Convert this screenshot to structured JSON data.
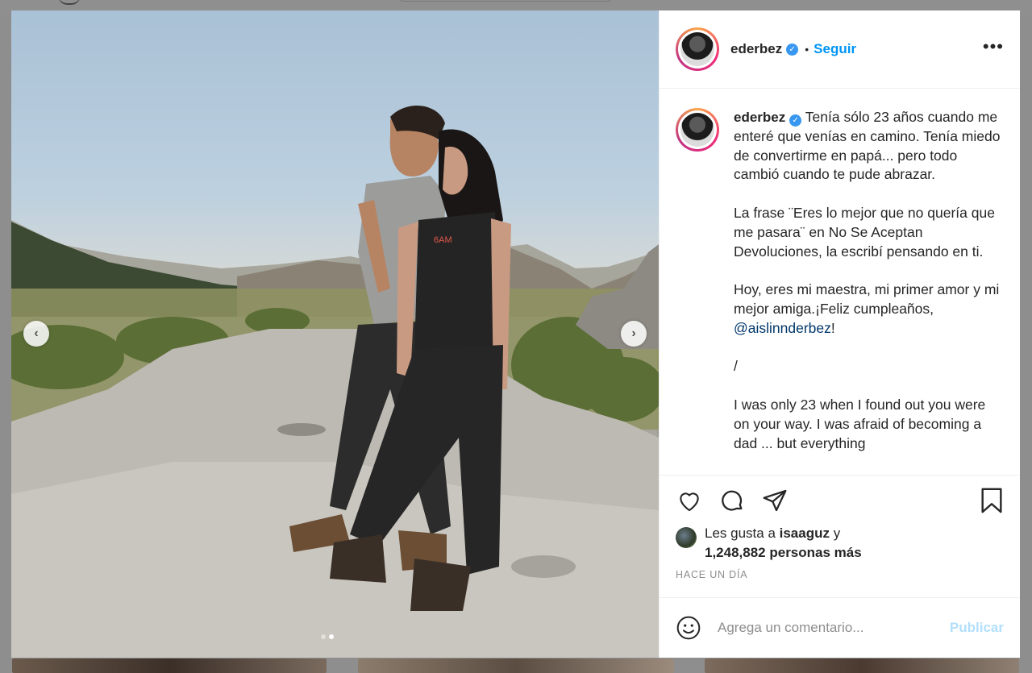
{
  "post": {
    "username": "ederbez",
    "separator": "•",
    "follow_label": "Seguir",
    "more_label": "•••",
    "verified_mark": "✓",
    "caption": {
      "paragraphs": [
        "Tenía sólo 23 años cuando me enteré que venías en camino. Tenía miedo de convertirme en papá... pero todo cambió cuando te pude abrazar.",
        "La frase ¨Eres lo mejor que no quería que me pasara¨ en No Se Aceptan Devoluciones, la escribí pensando en ti.",
        "Hoy, eres mi maestra, mi primer amor y mi mejor amiga.¡Feliz cumpleaños,",
        "/",
        "I was only 23 when I found out you were on your way. I was afraid of becoming a dad ... but everything"
      ],
      "mention": "@aislinnderbez",
      "mention_suffix": "!"
    },
    "likes": {
      "prefix": "Les gusta a ",
      "user": "isaaguz",
      "connector": " y",
      "count_text": "1,248,882 personas más"
    },
    "timestamp": "HACE UN DÍA",
    "comment": {
      "placeholder": "Agrega un comentario...",
      "publish_label": "Publicar"
    },
    "photo_shirt_text": "6AM",
    "carousel": {
      "slides": 2,
      "active_index": 1
    }
  },
  "icons": {
    "prev": "chevron-left-icon",
    "next": "chevron-right-icon",
    "like": "heart-icon",
    "comment": "comment-bubble-icon",
    "share": "paper-plane-icon",
    "save": "bookmark-icon",
    "emoji": "smiley-icon"
  },
  "colors": {
    "link_blue": "#0095f6",
    "mention_blue": "#00376b",
    "publish_disabled": "#b2dffc",
    "verified": "#3897f0",
    "text": "#262626",
    "muted": "#8e8e8e"
  }
}
